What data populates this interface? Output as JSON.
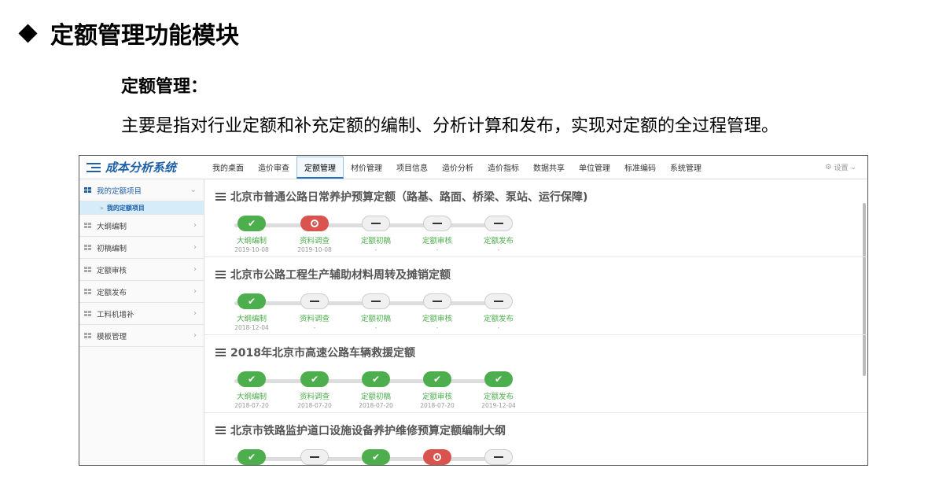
{
  "slide": {
    "title": "定额管理功能模块",
    "subtitle": "定额管理：",
    "description": "主要是指对行业定额和补充定额的编制、分析计算和发布，实现对定额的全过程管理。"
  },
  "app": {
    "logo_text": "成本分析系统",
    "nav": [
      "我的桌面",
      "造价审查",
      "定额管理",
      "材价管理",
      "项目信息",
      "造价分析",
      "造价指标",
      "数据共享",
      "单位管理",
      "标准编码",
      "系统管理"
    ],
    "active_nav": "定额管理",
    "settings_label": "设置",
    "sidebar": {
      "first": "我的定额项目",
      "sub": "我的定额项目",
      "items": [
        "大纲编制",
        "初稿编制",
        "定额审核",
        "定额发布",
        "工料机增补",
        "模板管理"
      ]
    },
    "projects": [
      {
        "title": "北京市普通公路日常养护预算定额（路基、路面、桥梁、泵站、运行保障)",
        "steps": [
          {
            "label": "大纲编制",
            "date": "2019-10-08",
            "status": "done"
          },
          {
            "label": "资料调查",
            "date": "2019-10-08",
            "status": "fail"
          },
          {
            "label": "定额初稿",
            "date": "-",
            "status": "todo"
          },
          {
            "label": "定额审核",
            "date": "-",
            "status": "todo"
          },
          {
            "label": "定额发布",
            "date": "-",
            "status": "todo"
          }
        ]
      },
      {
        "title": "北京市公路工程生产辅助材料周转及摊销定额",
        "steps": [
          {
            "label": "大纲编制",
            "date": "2018-12-04",
            "status": "done"
          },
          {
            "label": "资料调查",
            "date": "-",
            "status": "todo"
          },
          {
            "label": "定额初稿",
            "date": "-",
            "status": "todo"
          },
          {
            "label": "定额审核",
            "date": "-",
            "status": "todo"
          },
          {
            "label": "定额发布",
            "date": "-",
            "status": "todo"
          }
        ]
      },
      {
        "title": "2018年北京市高速公路车辆救援定额",
        "steps": [
          {
            "label": "大纲编制",
            "date": "2018-07-20",
            "status": "done"
          },
          {
            "label": "资料调查",
            "date": "2018-07-20",
            "status": "done"
          },
          {
            "label": "定额初稿",
            "date": "2018-07-20",
            "status": "done"
          },
          {
            "label": "定额审核",
            "date": "2018-07-20",
            "status": "done"
          },
          {
            "label": "定额发布",
            "date": "2019-12-04",
            "status": "done"
          }
        ]
      },
      {
        "title": "北京市铁路监护道口设施设备养护维修预算定额编制大纲",
        "steps": [
          {
            "label": "",
            "date": "",
            "status": "done"
          },
          {
            "label": "",
            "date": "",
            "status": "todo"
          },
          {
            "label": "",
            "date": "",
            "status": "done"
          },
          {
            "label": "",
            "date": "",
            "status": "fail"
          },
          {
            "label": "",
            "date": "",
            "status": "todo"
          }
        ]
      }
    ]
  }
}
